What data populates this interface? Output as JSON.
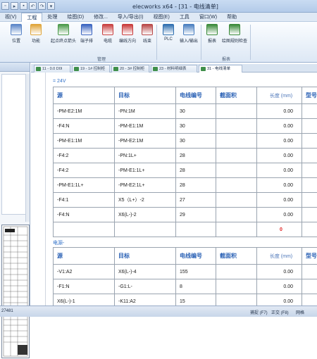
{
  "window": {
    "title": "elecworks x64 - [31 - 电线清单]"
  },
  "menu": [
    {
      "label": "视(V)",
      "active": false
    },
    {
      "label": "工程",
      "active": true
    },
    {
      "label": "处理",
      "active": false
    },
    {
      "label": "绘图(D)",
      "active": false
    },
    {
      "label": "修改...",
      "active": false
    },
    {
      "label": "导入/导出(I)",
      "active": false
    },
    {
      "label": "视图(E)",
      "active": false
    },
    {
      "label": "工具",
      "active": false
    },
    {
      "label": "窗口(W)",
      "active": false
    },
    {
      "label": "帮助",
      "active": false
    }
  ],
  "ribbon": {
    "buttons": [
      {
        "label": "位置",
        "icon": "location-icon",
        "color": "#5b86c8"
      },
      {
        "label": "功能",
        "icon": "function-icon",
        "color": "#e0a53a"
      },
      {
        "label": "起点终点箭头",
        "icon": "origin-destination-arrow-icon",
        "color": "#4a9a4a"
      },
      {
        "label": "端子排",
        "icon": "terminal-strip-icon",
        "color": "#3a64c0"
      },
      {
        "label": "电缆",
        "icon": "cable-icon",
        "color": "#c84040"
      },
      {
        "label": "编线方向",
        "icon": "wire-direction-icon",
        "color": "#c83a3a"
      },
      {
        "label": "线束",
        "icon": "harness-icon",
        "color": "#b84848"
      },
      {
        "label": "PLC",
        "icon": "plc-icon",
        "color": "#2f6fb0"
      },
      {
        "label": "输入/输出",
        "icon": "input-output-icon",
        "color": "#4a7fc0"
      },
      {
        "label": "报表",
        "icon": "report-icon",
        "color": "#3a8a3a"
      },
      {
        "label": "绘图规则检查",
        "icon": "drawing-rules-check-icon",
        "color": "#3a8a3a"
      }
    ],
    "groups": [
      {
        "label": "管理"
      },
      {
        "label": "报表"
      }
    ]
  },
  "tabs": [
    {
      "label": "11 - 0.0 D0I",
      "active": false
    },
    {
      "label": "19 - 1# 控制柜",
      "active": false
    },
    {
      "label": "20 - 3# 控制柜",
      "active": false
    },
    {
      "label": "23 - 材料明细表",
      "active": false
    },
    {
      "label": "31 - 电线清单",
      "active": true
    }
  ],
  "columns": [
    "源",
    "目标",
    "电线编号",
    "截面积",
    "长度 (mm)",
    "型号"
  ],
  "sections": [
    {
      "title": "24V",
      "rows": [
        {
          "src": "-PM-E2:1M",
          "dst": "-PN:1M",
          "wire": "30",
          "area": "",
          "len": "0.00",
          "type": ""
        },
        {
          "src": "-F4:N",
          "dst": "-PM-E1:1M",
          "wire": "30",
          "area": "",
          "len": "0.00",
          "type": ""
        },
        {
          "src": "-PM-E1:1M",
          "dst": "-PM-E2:1M",
          "wire": "30",
          "area": "",
          "len": "0.00",
          "type": ""
        },
        {
          "src": "-F4:2",
          "dst": "-PN:1L+",
          "wire": "28",
          "area": "",
          "len": "0.00",
          "type": ""
        },
        {
          "src": "-F4:2",
          "dst": "-PM-E1:1L+",
          "wire": "28",
          "area": "",
          "len": "0.00",
          "type": ""
        },
        {
          "src": "-PM-E1:1L+",
          "dst": "-PM-E2:1L+",
          "wire": "28",
          "area": "",
          "len": "0.00",
          "type": ""
        },
        {
          "src": "-F4:1",
          "dst": "X5（L+）-2",
          "wire": "27",
          "area": "",
          "len": "0.00",
          "type": ""
        },
        {
          "src": "-F4:N",
          "dst": "X6(L-)-2",
          "wire": "29",
          "area": "",
          "len": "0.00",
          "type": ""
        }
      ],
      "total": "0"
    },
    {
      "title": "电源-",
      "rows": [
        {
          "src": "-V1:A2",
          "dst": "X6(L-)-4",
          "wire": "155",
          "area": "",
          "len": "0.00",
          "type": ""
        },
        {
          "src": "-F1:N",
          "dst": "-G1:L-",
          "wire": "8",
          "area": "",
          "len": "0.00",
          "type": ""
        },
        {
          "src": "X6(L-)-1",
          "dst": "-K11:A2",
          "wire": "15",
          "area": "",
          "len": "0.00",
          "type": ""
        }
      ]
    }
  ],
  "status": {
    "coord": "27481",
    "snap": "捕捉 (F7)",
    "ortho": "正交 (F8)",
    "extra": "网格"
  }
}
